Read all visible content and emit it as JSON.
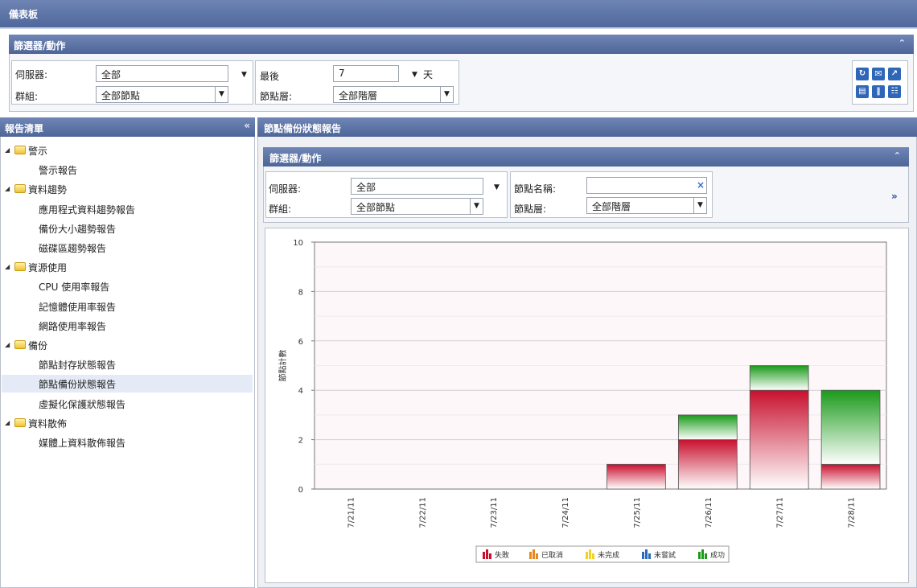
{
  "app": {
    "title": "儀表板"
  },
  "top_filter": {
    "title": "篩選器/動作",
    "server_label": "伺服器:",
    "server_value": "全部",
    "group_label": "群組:",
    "group_value": "全部節點",
    "last_label": "最後",
    "last_value": "7",
    "days_label": "天",
    "tier_label": "節點層:",
    "tier_value": "全部階層"
  },
  "sidebar": {
    "title": "報告清單",
    "items": [
      {
        "label": "警示",
        "type": "folder"
      },
      {
        "label": "警示報告",
        "type": "report"
      },
      {
        "label": "資料趨勢",
        "type": "folder"
      },
      {
        "label": "應用程式資料趨勢報告",
        "type": "report"
      },
      {
        "label": "備份大小趨勢報告",
        "type": "report"
      },
      {
        "label": "磁碟區趨勢報告",
        "type": "report"
      },
      {
        "label": "資源使用",
        "type": "folder"
      },
      {
        "label": "CPU 使用率報告",
        "type": "report"
      },
      {
        "label": "記憶體使用率報告",
        "type": "report"
      },
      {
        "label": "網路使用率報告",
        "type": "report"
      },
      {
        "label": "備份",
        "type": "folder"
      },
      {
        "label": "節點封存狀態報告",
        "type": "report"
      },
      {
        "label": "節點備份狀態報告",
        "type": "report",
        "selected": true
      },
      {
        "label": "虛擬化保護狀態報告",
        "type": "report"
      },
      {
        "label": "資料散佈",
        "type": "folder"
      },
      {
        "label": "媒體上資料散佈報告",
        "type": "report"
      }
    ]
  },
  "report": {
    "title": "節點備份狀態報告",
    "filter": {
      "title": "篩選器/動作",
      "server_label": "伺服器:",
      "server_value": "全部",
      "group_label": "群組:",
      "group_value": "全部節點",
      "node_name_label": "節點名稱:",
      "node_name_value": "",
      "tier_label": "節點層:",
      "tier_value": "全部階層"
    }
  },
  "chart_data": {
    "type": "bar",
    "stacked": true,
    "categories": [
      "7/21/11",
      "7/22/11",
      "7/23/11",
      "7/24/11",
      "7/25/11",
      "7/26/11",
      "7/27/11",
      "7/28/11"
    ],
    "series": [
      {
        "name": "失敗",
        "color": "#c8102e",
        "values": [
          0,
          0,
          0,
          0,
          1,
          2,
          4,
          1
        ]
      },
      {
        "name": "已取消",
        "color": "#e8871e",
        "values": [
          0,
          0,
          0,
          0,
          0,
          0,
          0,
          0
        ]
      },
      {
        "name": "未完成",
        "color": "#f2d024",
        "values": [
          0,
          0,
          0,
          0,
          0,
          0,
          0,
          0
        ]
      },
      {
        "name": "未嘗試",
        "color": "#2a6bbf",
        "values": [
          0,
          0,
          0,
          0,
          0,
          0,
          0,
          0
        ]
      },
      {
        "name": "成功",
        "color": "#1a9a1a",
        "values": [
          0,
          0,
          0,
          0,
          0,
          1,
          1,
          3
        ]
      }
    ],
    "ylabel": "節點計數",
    "ylim": [
      0,
      10
    ],
    "yticks": [
      0,
      2,
      4,
      6,
      8,
      10
    ],
    "grid": true,
    "legend_position": "bottom"
  }
}
